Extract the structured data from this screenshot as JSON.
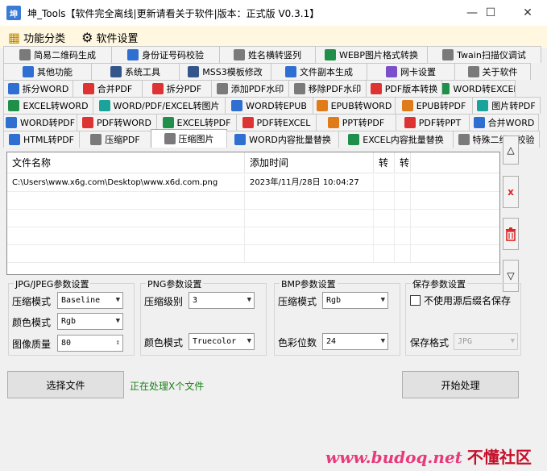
{
  "window": {
    "title": "坤_Tools【软件完全离线|更新请看关于软件|版本：正式版 V0.3.1】",
    "app_icon": "坤",
    "controls": {
      "minimize": "—",
      "maximize": "☐",
      "close": "✕"
    }
  },
  "menubar": {
    "items": [
      {
        "label": "功能分类",
        "icon": "category-icon"
      },
      {
        "label": "软件设置",
        "icon": "gear-icon"
      }
    ]
  },
  "tab_rows": [
    [
      {
        "label": "简易二维码生成",
        "icon": "qrcode-icon",
        "color": "#7a7a7a"
      },
      {
        "label": "身份证号码校验",
        "icon": "id-card-icon",
        "color": "#2f6fd1"
      },
      {
        "label": "姓名横转竖列",
        "icon": "name-icon",
        "color": "#7a7a7a"
      },
      {
        "label": "WEBP图片格式转换",
        "icon": "image-icon",
        "color": "#1f8f4a"
      },
      {
        "label": "Twain扫描仪调试",
        "icon": "scanner-icon",
        "color": "#7a7a7a"
      }
    ],
    [
      {
        "label": "其他功能",
        "icon": "other-icon",
        "color": "#2f6fd1"
      },
      {
        "label": "系统工具",
        "icon": "gear-icon",
        "color": "#33558a"
      },
      {
        "label": "MSS3模板修改",
        "icon": "gear-icon",
        "color": "#33558a"
      },
      {
        "label": "文件副本生成",
        "icon": "file-copy-icon",
        "color": "#2f6fd1"
      },
      {
        "label": "网卡设置",
        "icon": "network-icon",
        "color": "#7b4fc9"
      },
      {
        "label": "关于软件",
        "icon": "info-icon",
        "color": "#7a7a7a"
      }
    ],
    [
      {
        "label": "拆分WORD",
        "icon": "word-icon",
        "color": "#2f6fd1"
      },
      {
        "label": "合并PDF",
        "icon": "pdf-icon",
        "color": "#d33"
      },
      {
        "label": "拆分PDF",
        "icon": "pdf-icon",
        "color": "#d33"
      },
      {
        "label": "添加PDF水印",
        "icon": "watermark-icon",
        "color": "#7a7a7a"
      },
      {
        "label": "移除PDF水印",
        "icon": "watermark-icon",
        "color": "#7a7a7a"
      },
      {
        "label": "PDF版本转换",
        "icon": "pdf-icon",
        "color": "#d33"
      },
      {
        "label": "WORD转EXCEL",
        "icon": "excel-icon",
        "color": "#1f8f4a"
      }
    ],
    [
      {
        "label": "EXCEL转WORD",
        "icon": "excel-icon",
        "color": "#1f8f4a"
      },
      {
        "label": "WORD/PDF/EXCEL转图片",
        "icon": "image-icon",
        "color": "#1aa39a"
      },
      {
        "label": "WORD转EPUB",
        "icon": "word-icon",
        "color": "#2f6fd1"
      },
      {
        "label": "EPUB转WORD",
        "icon": "epub-icon",
        "color": "#e07b1a"
      },
      {
        "label": "EPUB转PDF",
        "icon": "epub-icon",
        "color": "#e07b1a"
      },
      {
        "label": "图片转PDF",
        "icon": "image-icon",
        "color": "#1aa39a"
      }
    ],
    [
      {
        "label": "WORD转PDF",
        "icon": "word-icon",
        "color": "#2f6fd1"
      },
      {
        "label": "PDF转WORD",
        "icon": "pdf-icon",
        "color": "#d33"
      },
      {
        "label": "EXCEL转PDF",
        "icon": "excel-icon",
        "color": "#1f8f4a"
      },
      {
        "label": "PDF转EXCEL",
        "icon": "pdf-icon",
        "color": "#d33"
      },
      {
        "label": "PPT转PDF",
        "icon": "ppt-icon",
        "color": "#e07b1a"
      },
      {
        "label": "PDF转PPT",
        "icon": "pdf-icon",
        "color": "#d33"
      },
      {
        "label": "合并WORD",
        "icon": "word-icon",
        "color": "#2f6fd1"
      }
    ],
    [
      {
        "label": "HTML转PDF",
        "icon": "html-icon",
        "color": "#2f6fd1"
      },
      {
        "label": "压缩PDF",
        "icon": "compress-icon",
        "color": "#7a7a7a"
      },
      {
        "label": "压缩图片",
        "icon": "compress-icon",
        "color": "#7a7a7a",
        "active": true
      },
      {
        "label": "WORD内容批量替换",
        "icon": "word-icon",
        "color": "#2f6fd1"
      },
      {
        "label": "EXCEL内容批量替换",
        "icon": "excel-icon",
        "color": "#1f8f4a"
      },
      {
        "label": "特殊二维码校验",
        "icon": "qrcode-icon",
        "color": "#7a7a7a"
      }
    ]
  ],
  "filelist": {
    "headers": [
      "文件名称",
      "添加时间",
      "转",
      "转"
    ],
    "rows": [
      {
        "name": "C:\\Users\\www.x6g.com\\Desktop\\www.x6d.com.png",
        "time": "2023年/11月/28日 10:04:27",
        "z1": "",
        "z2": ""
      }
    ]
  },
  "side_buttons": {
    "up": "△",
    "remove": "x",
    "clear": "trash-icon",
    "down": "▽"
  },
  "jpg_group": {
    "title": "JPG/JPEG参数设置",
    "compress_mode_label": "压缩模式",
    "compress_mode_value": "Baseline",
    "color_mode_label": "颜色模式",
    "color_mode_value": "Rgb",
    "quality_label": "图像质量",
    "quality_value": "80"
  },
  "png_group": {
    "title": "PNG参数设置",
    "level_label": "压缩级别",
    "level_value": "3",
    "color_mode_label": "颜色模式",
    "color_mode_value": "Truecolor"
  },
  "bmp_group": {
    "title": "BMP参数设置",
    "compress_mode_label": "压缩模式",
    "compress_mode_value": "Rgb",
    "depth_label": "色彩位数",
    "depth_value": "24"
  },
  "save_group": {
    "title": "保存参数设置",
    "keep_suffix_label": "不使用源后缀名保存",
    "keep_suffix_checked": false,
    "format_label": "保存格式",
    "format_value": "JPG"
  },
  "actions": {
    "select_file": "选择文件",
    "status": "正在处理X个文件",
    "start": "开始处理"
  },
  "watermark": {
    "site": "www.budoq.net",
    "name": "不懂社区"
  }
}
